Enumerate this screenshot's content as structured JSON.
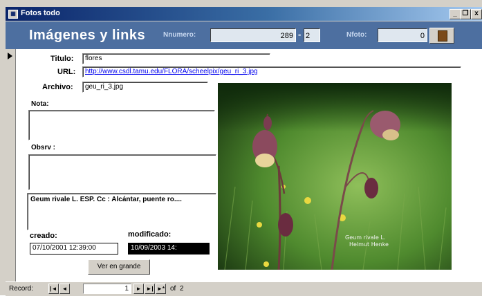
{
  "window": {
    "title": "Fotos todo",
    "minimize": "_",
    "restore": "❐",
    "close": "x"
  },
  "header": {
    "title": "Imágenes y links",
    "nnumero_label": "Nnumero:",
    "nnumero_value": "289",
    "sub_value": "2",
    "nfoto_label": "Nfoto:",
    "nfoto_value": "0",
    "exit_icon": "exit-door-icon"
  },
  "form": {
    "titulo_label": "Titulo:",
    "titulo_value": "flores",
    "url_label": "URL:",
    "url_value": "http://www.csdl.tamu.edu/FLORA/scheelpix/geu_ri_3.jpg",
    "archivo_label": "Archivo:",
    "archivo_value": "geu_ri_3.jpg",
    "nota_label": "Nota:",
    "obsrv_label": "Obsrv :",
    "description": "Geum rivale L.     ESP. Cc : Alcántar, puente ro....",
    "creado_label": "creado:",
    "creado_value": "07/10/2001 12:39:00",
    "modificado_label": "modificado:",
    "modificado_value": "10/09/2003 14:",
    "ver_button": "Ver en grande",
    "photo_caption_1": "Geum rivale L.",
    "photo_caption_2": "Helmut Henke"
  },
  "nav": {
    "record_label": "Record:",
    "first": "|◄",
    "prev": "◄",
    "current": "1",
    "next": "►",
    "last": "►|",
    "new": "►*",
    "of_label": "of",
    "total": "2"
  }
}
